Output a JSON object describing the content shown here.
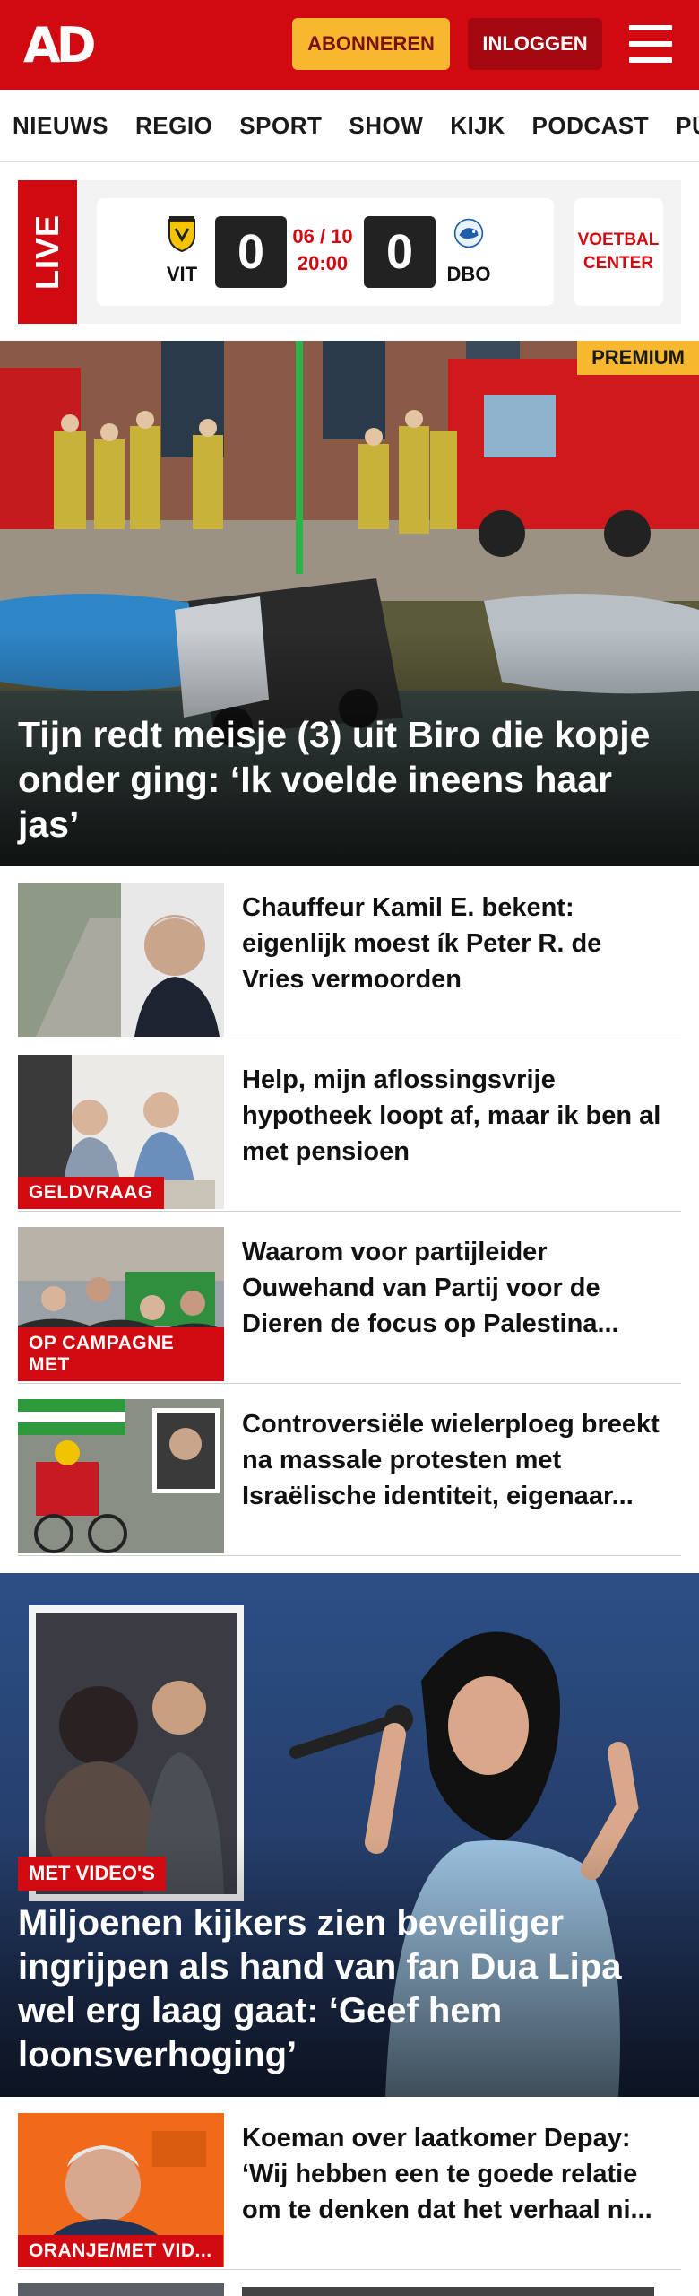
{
  "header": {
    "logo": "AD",
    "subscribe_label": "ABONNEREN",
    "login_label": "INLOGGEN"
  },
  "nav": {
    "items": [
      {
        "label": "NIEUWS"
      },
      {
        "label": "REGIO"
      },
      {
        "label": "SPORT"
      },
      {
        "label": "SHOW"
      },
      {
        "label": "KIJK"
      },
      {
        "label": "PODCAST"
      },
      {
        "label": "PUZZ"
      }
    ]
  },
  "live": {
    "badge": "LIVE",
    "home_team": "VIT",
    "away_team": "DBO",
    "home_score": "0",
    "away_score": "0",
    "date": "06 / 10",
    "time": "20:00",
    "center_label": "VOETBAL CENTER"
  },
  "hero": {
    "badge": "PREMIUM",
    "title": "Tijn redt meisje (3) uit Biro die kopje onder ging: ‘Ik voelde ineens haar jas’"
  },
  "articles": [
    {
      "title": "Chauffeur Kamil E. bekent: eigenlijk moest ík Peter R. de Vries vermoorden",
      "tag": ""
    },
    {
      "title": "Help, mijn aflossingsvrije hypotheek loopt af, maar ik ben al met pensioen",
      "tag": "GELDVRAAG"
    },
    {
      "title": "Waarom voor partijleider Ouwehand van Partij voor de Dieren de focus op Palestina...",
      "tag": "OP CAMPAGNE MET"
    },
    {
      "title": "Controversiële wielerploeg breekt na massale protesten met Israëlische identiteit, eigenaar...",
      "tag": ""
    }
  ],
  "feature": {
    "tag": "MET VIDEO'S",
    "title": "Miljoenen kijkers zien beveiliger ingrijpen als hand van fan Dua Lipa wel erg laag gaat: ‘Geef hem loonsverhoging’"
  },
  "articles2": [
    {
      "title": "Koeman over laatkomer Depay: ‘Wij hebben een te goede relatie om te denken dat het verhaal ni...",
      "tag": "ORANJE/MET VID..."
    }
  ],
  "colors": {
    "brand_red": "#d10a11",
    "accent_yellow": "#f5b82e"
  }
}
